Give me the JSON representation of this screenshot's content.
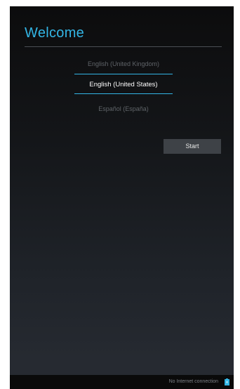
{
  "welcome": {
    "title": "Welcome"
  },
  "languages": {
    "items": [
      {
        "label": "English (United Kingdom)",
        "selected": false
      },
      {
        "label": "English (United States)",
        "selected": true
      },
      {
        "label": "Español (España)",
        "selected": false
      }
    ]
  },
  "actions": {
    "start_label": "Start"
  },
  "status_bar": {
    "connection_text": "No Internet connection",
    "icon": "battery-icon"
  },
  "colors": {
    "accent": "#33b5e5",
    "background_top": "#0c0c0d",
    "background_bottom": "#262a31",
    "button": "#3e4247"
  }
}
